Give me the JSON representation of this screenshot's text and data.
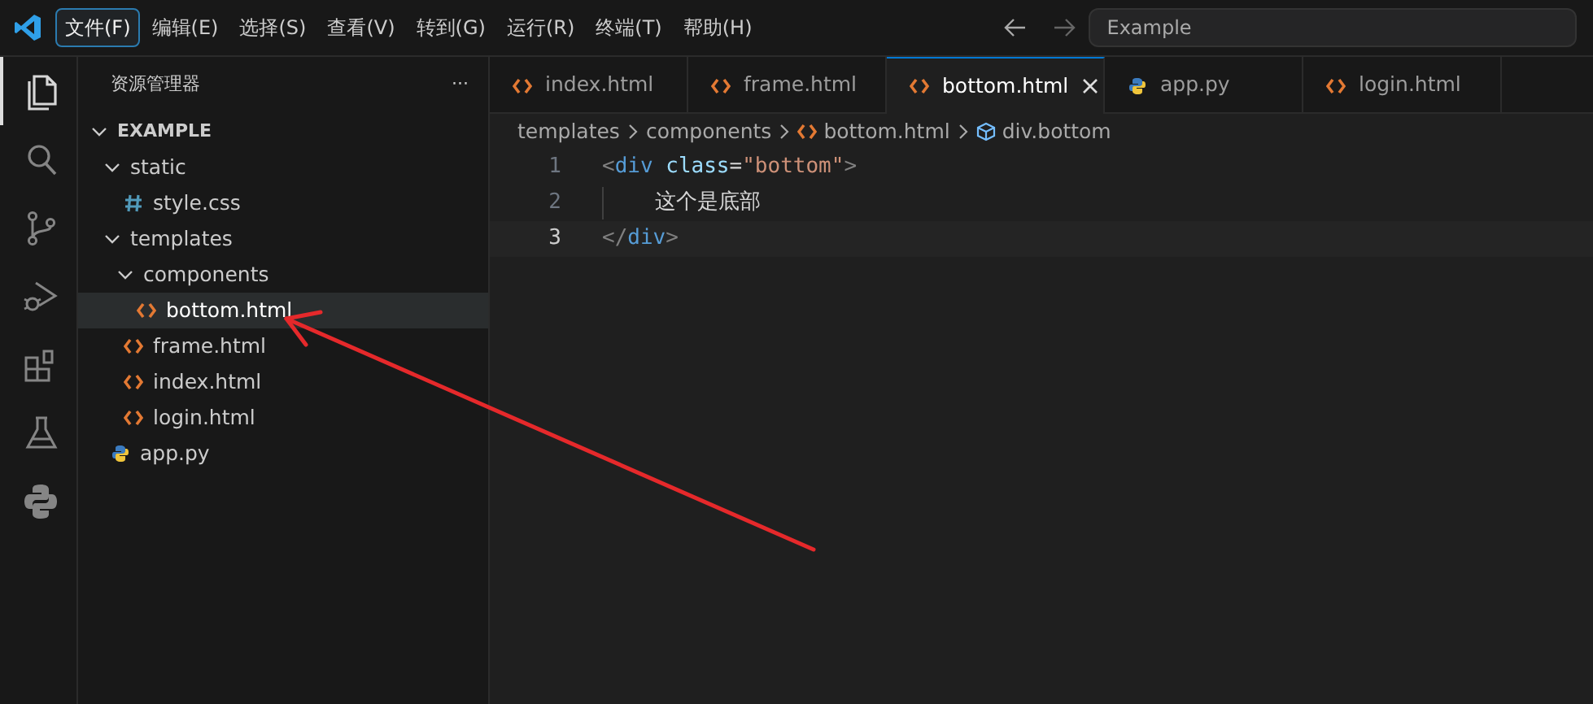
{
  "menu_bar": {
    "items": [
      {
        "label": "文件(F)",
        "selected": true
      },
      {
        "label": "编辑(E)",
        "selected": false
      },
      {
        "label": "选择(S)",
        "selected": false
      },
      {
        "label": "查看(V)",
        "selected": false
      },
      {
        "label": "转到(G)",
        "selected": false
      },
      {
        "label": "运行(R)",
        "selected": false
      },
      {
        "label": "终端(T)",
        "selected": false
      },
      {
        "label": "帮助(H)",
        "selected": false
      }
    ],
    "search": {
      "placeholder": "Example"
    }
  },
  "activity_bar": [
    {
      "kind": "files",
      "selected": true
    },
    {
      "kind": "search",
      "selected": false
    },
    {
      "kind": "source-control",
      "selected": false
    },
    {
      "kind": "run-debug",
      "selected": false
    },
    {
      "kind": "extensions",
      "selected": false
    },
    {
      "kind": "testing",
      "selected": false
    },
    {
      "kind": "python",
      "selected": false
    }
  ],
  "sidebar": {
    "title": "资源管理器",
    "more": "···",
    "tree": [
      {
        "label": "EXAMPLE",
        "kind": "root",
        "expanded": true,
        "selected": false,
        "children": [
          {
            "label": "static",
            "kind": "folder",
            "expanded": true,
            "selected": false,
            "children": [
              {
                "label": "style.css",
                "kind": "css",
                "selected": false
              }
            ]
          },
          {
            "label": "templates",
            "kind": "folder",
            "expanded": true,
            "selected": false,
            "children": [
              {
                "label": "components",
                "kind": "folder",
                "expanded": true,
                "selected": false,
                "children": [
                  {
                    "label": "bottom.html",
                    "kind": "html",
                    "selected": true
                  }
                ]
              },
              {
                "label": "frame.html",
                "kind": "html",
                "selected": false
              },
              {
                "label": "index.html",
                "kind": "html",
                "selected": false
              },
              {
                "label": "login.html",
                "kind": "html",
                "selected": false
              }
            ]
          },
          {
            "label": "app.py",
            "kind": "py",
            "selected": false
          }
        ]
      }
    ]
  },
  "tabs": [
    {
      "label": "index.html",
      "kind": "html",
      "selected": false
    },
    {
      "label": "frame.html",
      "kind": "html",
      "selected": false
    },
    {
      "label": "bottom.html",
      "kind": "html",
      "selected": true
    },
    {
      "label": "app.py",
      "kind": "py",
      "selected": false
    },
    {
      "label": "login.html",
      "kind": "html",
      "selected": false
    }
  ],
  "breadcrumb": [
    {
      "label": "templates",
      "kind": "folder"
    },
    {
      "label": "components",
      "kind": "folder"
    },
    {
      "label": "bottom.html",
      "kind": "html"
    },
    {
      "label": "div.bottom",
      "kind": "symbol"
    }
  ],
  "editor": {
    "lines": [
      {
        "number": "1",
        "current": false,
        "tokens": [
          {
            "text": "<",
            "kind": "punct"
          },
          {
            "text": "div",
            "kind": "tag"
          },
          {
            "text": "class",
            "kind": "attr"
          },
          {
            "text": "=",
            "kind": "plain"
          },
          {
            "text": "\"bottom\"",
            "kind": "string"
          },
          {
            "text": ">",
            "kind": "punct"
          }
        ]
      },
      {
        "number": "2",
        "current": false,
        "indented": true,
        "tokens": [
          {
            "text": "这个是底部",
            "kind": "plain"
          }
        ]
      },
      {
        "number": "3",
        "current": true,
        "tokens": [
          {
            "text": "</",
            "kind": "punct"
          },
          {
            "text": "div",
            "kind": "tag"
          },
          {
            "text": ">",
            "kind": "punct"
          }
        ]
      }
    ]
  }
}
